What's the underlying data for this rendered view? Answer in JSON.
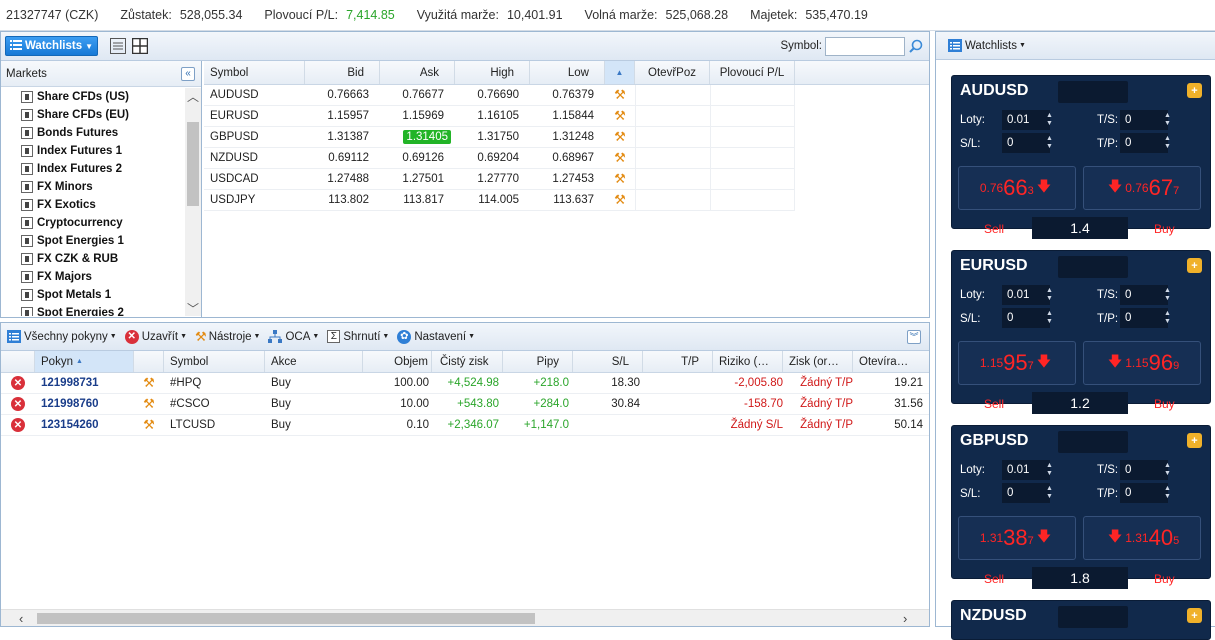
{
  "account": {
    "id": "21327747 (CZK)",
    "balance_label": "Zůstatek:",
    "balance": "528,055.34",
    "floating_label": "Plovoucí P/L:",
    "floating": "7,414.85",
    "margin_label": "Využitá marže:",
    "margin": "10,401.91",
    "free_label": "Volná marže:",
    "free": "525,068.28",
    "equity_label": "Majetek:",
    "equity": "535,470.19"
  },
  "left_toolbar": {
    "watchlists_label": "Watchlists",
    "symbol_label": "Symbol:"
  },
  "markets": {
    "title": "Markets",
    "items": [
      "Share CFDs (US)",
      "Share CFDs (EU)",
      "Bonds Futures",
      "Index Futures 1",
      "Index Futures 2",
      "FX Minors",
      "FX Exotics",
      "Cryptocurrency",
      "Spot Energies 1",
      "FX CZK & RUB",
      "FX Majors",
      "Spot Metals 1",
      "Spot Energies 2"
    ]
  },
  "quotes": {
    "headers": {
      "symbol": "Symbol",
      "bid": "Bid",
      "ask": "Ask",
      "high": "High",
      "low": "Low",
      "open": "OtevřPoz",
      "pl": "Plovoucí P/L"
    },
    "rows": [
      {
        "symbol": "AUDUSD",
        "bid": "0.76663",
        "ask": "0.76677",
        "high": "0.76690",
        "low": "0.76379"
      },
      {
        "symbol": "EURUSD",
        "bid": "1.15957",
        "ask": "1.15969",
        "high": "1.16105",
        "low": "1.15844"
      },
      {
        "symbol": "GBPUSD",
        "bid": "1.31387",
        "ask": "1.31405",
        "high": "1.31750",
        "low": "1.31248"
      },
      {
        "symbol": "NZDUSD",
        "bid": "0.69112",
        "ask": "0.69126",
        "high": "0.69204",
        "low": "0.68967"
      },
      {
        "symbol": "USDCAD",
        "bid": "1.27488",
        "ask": "1.27501",
        "high": "1.27770",
        "low": "1.27453"
      },
      {
        "symbol": "USDJPY",
        "bid": "113.802",
        "ask": "113.817",
        "high": "114.005",
        "low": "113.637"
      }
    ],
    "highlight_color": "#22b427"
  },
  "orders_toolbar": {
    "all_orders": "Všechny pokyny",
    "close": "Uzavřít",
    "tools": "Nástroje",
    "oca": "OCA",
    "summary": "Shrnutí",
    "settings": "Nastavení"
  },
  "positions": {
    "headers": {
      "order": "Pokyn",
      "symbol": "Symbol",
      "action": "Akce",
      "volume": "Objem",
      "net": "Čistý zisk",
      "pips": "Pipy",
      "sl": "S/L",
      "tp": "T/P",
      "risk": "Riziko (…",
      "profit": "Zisk (or…",
      "open": "Otevíra…"
    },
    "rows": [
      {
        "order": "121998731",
        "symbol": "#HPQ",
        "action": "Buy",
        "volume": "100.00",
        "net": "+4,524.98",
        "pips": "+218.0",
        "sl": "18.30",
        "tp": "",
        "risk": "-2,005.80",
        "profit": "Žádný T/P",
        "open": "19.21"
      },
      {
        "order": "121998760",
        "symbol": "#CSCO",
        "action": "Buy",
        "volume": "10.00",
        "net": "+543.80",
        "pips": "+284.0",
        "sl": "30.84",
        "tp": "",
        "risk": "-158.70",
        "profit": "Žádný T/P",
        "open": "31.56"
      },
      {
        "order": "123154260",
        "symbol": "LTCUSD",
        "action": "Buy",
        "volume": "0.10",
        "net": "+2,346.07",
        "pips": "+1,147.0",
        "sl": "",
        "tp": "",
        "risk": "Žádný S/L",
        "profit": "Žádný T/P",
        "open": "50.14"
      }
    ]
  },
  "right_panel": {
    "watchlists_label": "Watchlists",
    "labels": {
      "lots": "Loty:",
      "ts": "T/S:",
      "sl": "S/L:",
      "tp": "T/P:",
      "sell": "Sell",
      "buy": "Buy"
    },
    "tickets": [
      {
        "symbol": "AUDUSD",
        "lots": "0.01",
        "ts": "0",
        "sl": "0",
        "tp": "0",
        "sell_small": "0.76",
        "sell_big": "66",
        "sell_tiny": "3",
        "buy_small": "0.76",
        "buy_big": "67",
        "buy_tiny": "7",
        "spread": "1.4"
      },
      {
        "symbol": "EURUSD",
        "lots": "0.01",
        "ts": "0",
        "sl": "0",
        "tp": "0",
        "sell_small": "1.15",
        "sell_big": "95",
        "sell_tiny": "7",
        "buy_small": "1.15",
        "buy_big": "96",
        "buy_tiny": "9",
        "spread": "1.2"
      },
      {
        "symbol": "GBPUSD",
        "lots": "0.01",
        "ts": "0",
        "sl": "0",
        "tp": "0",
        "sell_small": "1.31",
        "sell_big": "38",
        "sell_tiny": "7",
        "buy_small": "1.31",
        "buy_big": "40",
        "buy_tiny": "5",
        "spread": "1.8"
      },
      {
        "symbol": "NZDUSD"
      }
    ]
  }
}
